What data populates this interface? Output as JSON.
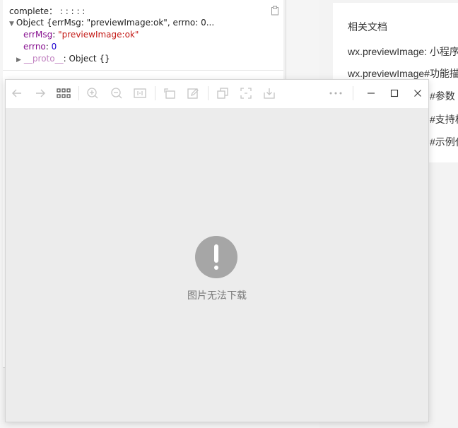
{
  "docs": {
    "title": "相关文档",
    "links": [
      "wx.previewImage: 小程序",
      "wx.previewImage#功能描述",
      "#参数",
      "#支持格式",
      "#示例代码"
    ]
  },
  "console": {
    "complete_line": "complete： : : : : :",
    "object_summary": "Object {errMsg: \"previewImage:ok\", errno: 0...",
    "errmsg_key": "errMsg",
    "errmsg_value": "\"previewImage:ok\"",
    "errno_key": "errno",
    "errno_value": "0",
    "proto_key": "__proto__",
    "proto_value": "Object {}",
    "copy_icon": "clipboard-icon"
  },
  "viewer": {
    "toolbar_icons": [
      "back-arrow-icon",
      "forward-arrow-icon",
      "grid-icon",
      "zoom-in-icon",
      "zoom-out-icon",
      "fit-size-icon",
      "rotate-icon",
      "edit-icon",
      "copy-icon",
      "crop-icon",
      "download-icon",
      "more-icon",
      "minimize-icon",
      "maximize-icon",
      "close-icon"
    ],
    "error_icon": "exclamation-icon",
    "error_text": "图片无法下载"
  },
  "colors": {
    "console_purple": "#881391",
    "console_string": "#c41a16",
    "console_number": "#1c00cf",
    "viewer_background": "#ececec",
    "error_icon_gray": "#a6a6a6"
  }
}
